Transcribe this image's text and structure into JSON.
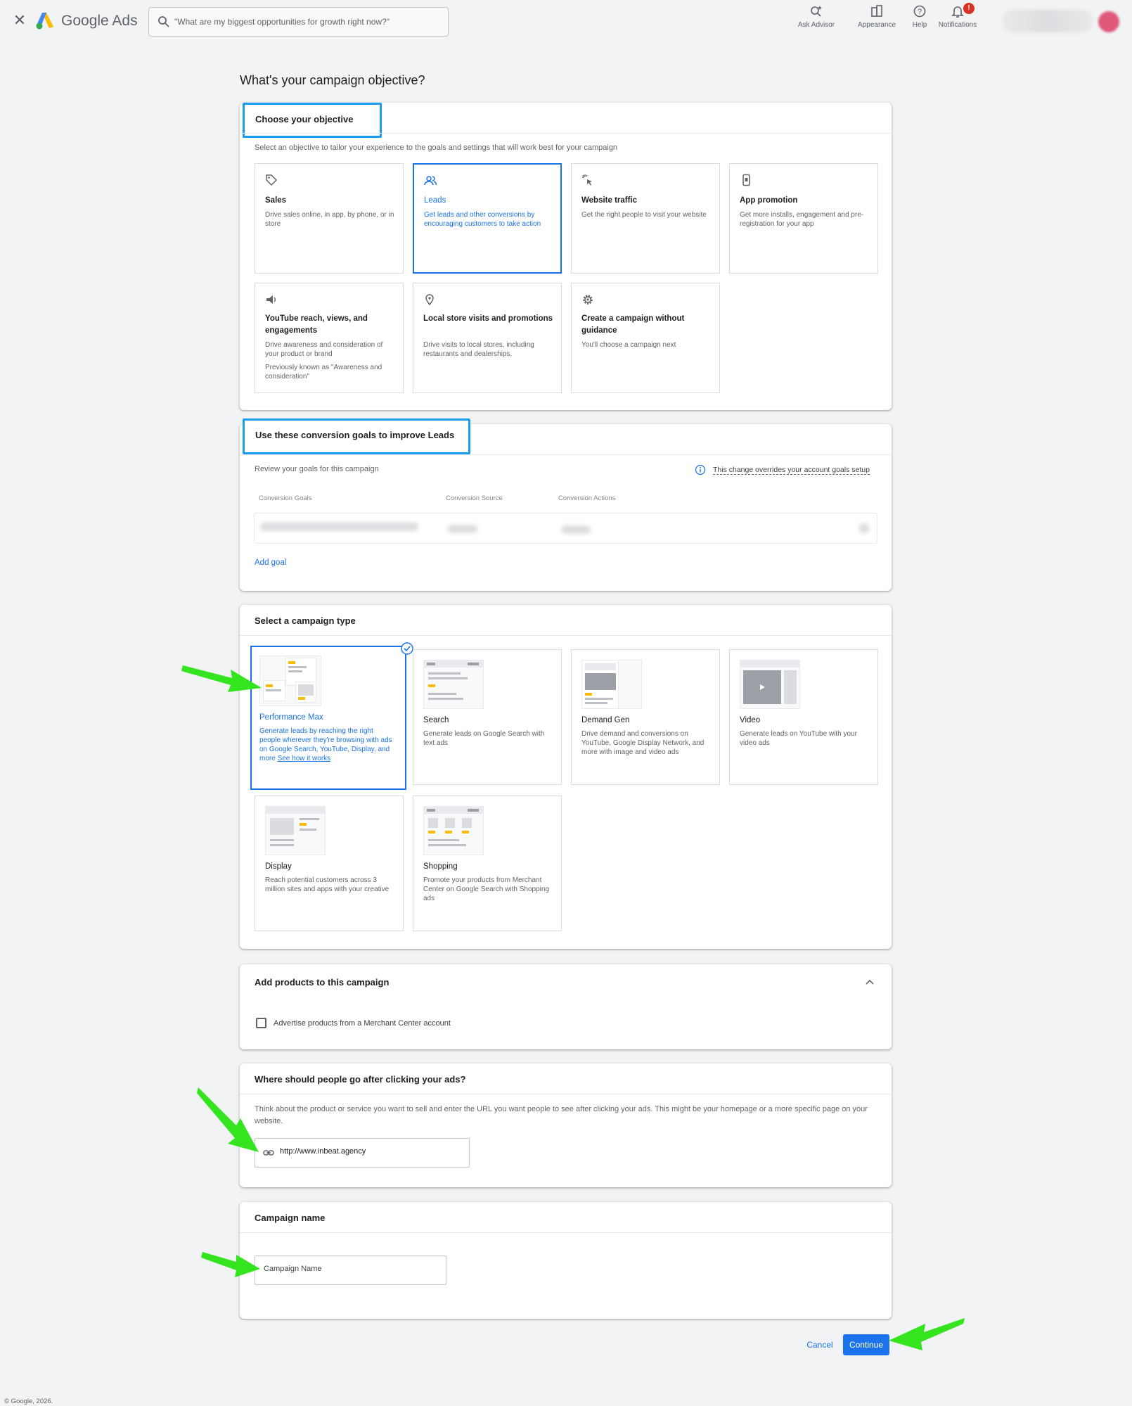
{
  "header": {
    "close_label": "✕",
    "brand": "Google Ads",
    "search_placeholder": "\"What are my biggest opportunities for growth right now?\"",
    "tools": [
      {
        "label": "Ask Advisor"
      },
      {
        "label": "Appearance"
      },
      {
        "label": "Help"
      },
      {
        "label": "Notifications"
      }
    ],
    "notifications_badge": "!"
  },
  "page_title": "What's your campaign objective?",
  "objective": {
    "heading": "Choose your objective",
    "subtitle": "Select an objective to tailor your experience to the goals and settings that will work best for your campaign",
    "options": [
      {
        "title": "Sales",
        "desc": "Drive sales online, in app, by phone, or in store",
        "icon": "tag-icon"
      },
      {
        "title": "Leads",
        "desc": "Get leads and other conversions by encouraging customers to take action",
        "icon": "people-icon",
        "selected": true
      },
      {
        "title": "Website traffic",
        "desc": "Get the right people to visit your website",
        "icon": "cursor-click-icon"
      },
      {
        "title": "App promotion",
        "desc": "Get more installs, engagement and pre-registration for your app",
        "icon": "phone-icon"
      },
      {
        "title": "YouTube reach, views, and engagements",
        "desc": "Drive awareness and consideration of your product or brand",
        "extra": "Previously known as \"Awareness and consideration\"",
        "icon": "speaker-icon"
      },
      {
        "title": "Local store visits and promotions",
        "desc": "Drive visits to local stores, including restaurants and dealerships.",
        "icon": "location-pin-icon"
      },
      {
        "title": "Create a campaign without guidance",
        "desc": "You'll choose a campaign next",
        "icon": "gear-icon"
      }
    ]
  },
  "conversion": {
    "heading": "Use these conversion goals to improve Leads",
    "subtitle": "Review your goals for this campaign",
    "override_note": "This change overrides your account goals setup",
    "columns": [
      "Conversion Goals",
      "Conversion Source",
      "Conversion Actions"
    ],
    "add_goal": "Add goal"
  },
  "campaign_type": {
    "heading": "Select a campaign type",
    "options": [
      {
        "title": "Performance Max",
        "desc": "Generate leads by reaching the right people wherever they're browsing with ads on Google Search, YouTube, Display, and more",
        "link": "See how it works",
        "selected": true
      },
      {
        "title": "Search",
        "desc": "Generate leads on Google Search with text ads"
      },
      {
        "title": "Demand Gen",
        "desc": "Drive demand and conversions on YouTube, Google Display Network, and more with image and video ads"
      },
      {
        "title": "Video",
        "desc": "Generate leads on YouTube with your video ads"
      },
      {
        "title": "Display",
        "desc": "Reach potential customers across 3 million sites and apps with your creative"
      },
      {
        "title": "Shopping",
        "desc": "Promote your products from Merchant Center on Google Search with Shopping ads"
      }
    ]
  },
  "products": {
    "heading": "Add products to this campaign",
    "checkbox_label": "Advertise products from a Merchant Center account"
  },
  "destination": {
    "heading": "Where should people go after clicking your ads?",
    "description": "Think about the product or service you want to sell and enter the URL you want people to see after clicking your ads. This might be your homepage or a more specific page on your website.",
    "url_value": "http://www.inbeat.agency"
  },
  "campaign_name": {
    "heading": "Campaign name",
    "placeholder": "Campaign Name"
  },
  "actions": {
    "cancel": "Cancel",
    "continue": "Continue"
  },
  "footer": "© Google, 2026.",
  "colors": {
    "accent": "#1a73e8",
    "highlight": "#1a9cf0",
    "annotation_arrow": "#33e41f"
  }
}
